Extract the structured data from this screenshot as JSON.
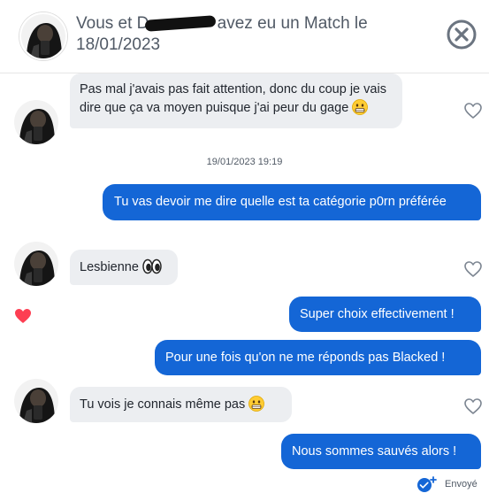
{
  "header": {
    "title_part1": "Vous et D",
    "title_part2": "avez eu un Match le 18/01/2023",
    "close_icon": "close-circle-icon"
  },
  "messages": [
    {
      "text": "Pas mal j'avais pas fait attention, donc du coup je vais dire que ça va moyen puisque j'ai peur du gage",
      "emoji": "grimace-emoji"
    },
    {
      "text": "Tu vas devoir me dire quelle est ta catégorie p0rn préférée"
    },
    {
      "text": "Lesbienne",
      "emoji": "eyes-emoji"
    },
    {
      "text": "Super choix effectivement !"
    },
    {
      "text": "Pour une fois qu'on ne me réponds pas Blacked !"
    },
    {
      "text": "Tu vois je connais même pas",
      "emoji": "grimace-emoji"
    },
    {
      "text": "Nous sommes sauvés alors !"
    }
  ],
  "timestamp": "19/01/2023 19:19",
  "status": {
    "label": "Envoyé",
    "icon": "delivered-check-icon"
  },
  "colors": {
    "outgoing": "#1466d6",
    "incoming": "#eceef1",
    "heart": "#fd3e52"
  }
}
